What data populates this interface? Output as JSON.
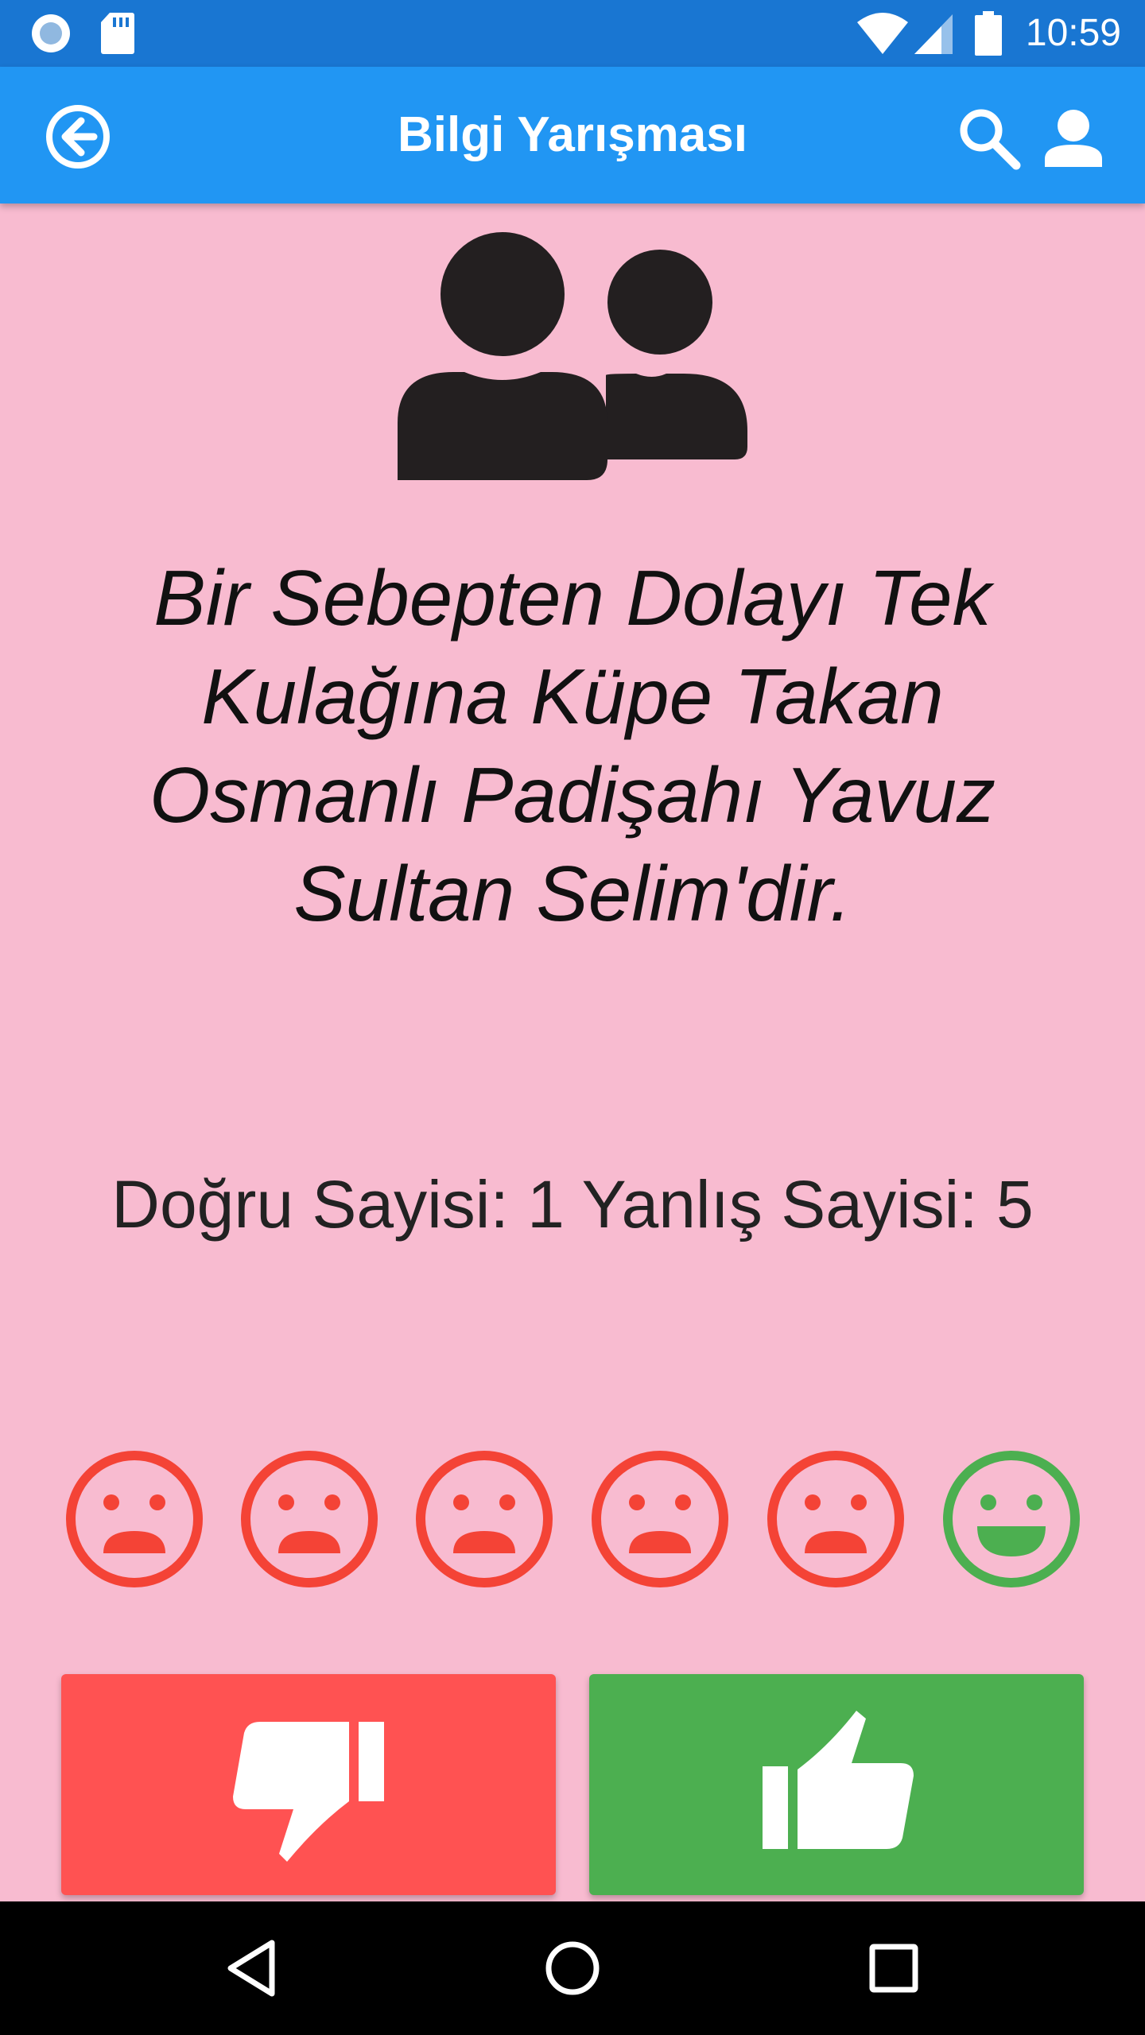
{
  "status_bar": {
    "time": "10:59"
  },
  "app_bar": {
    "title": "Bilgi Yarışması",
    "icons": [
      "back-arrow-circle-icon",
      "search-icon",
      "account-icon"
    ]
  },
  "question": {
    "icon": "people-icon",
    "text": "Bir Sebepten Dolayı Tek Kulağına Küpe Takan Osmanlı Padişahı Yavuz Sultan Selim'dir."
  },
  "score": {
    "text": "Doğru Sayisi: 1 Yanlış Sayisi: 5"
  },
  "results": [
    {
      "state": "wrong",
      "icon": "sad-face-icon",
      "color": "#f44336"
    },
    {
      "state": "wrong",
      "icon": "sad-face-icon",
      "color": "#f44336"
    },
    {
      "state": "wrong",
      "icon": "sad-face-icon",
      "color": "#f44336"
    },
    {
      "state": "wrong",
      "icon": "sad-face-icon",
      "color": "#f44336"
    },
    {
      "state": "wrong",
      "icon": "sad-face-icon",
      "color": "#f44336"
    },
    {
      "state": "correct",
      "icon": "happy-face-icon",
      "color": "#4caf50"
    }
  ],
  "buttons": {
    "false": {
      "icon": "thumbs-down-icon",
      "color": "#ff5252"
    },
    "true": {
      "icon": "thumbs-up-icon",
      "color": "#4caf50"
    }
  },
  "colors": {
    "status_bar": "#1976d2",
    "app_bar": "#2196f3",
    "background": "#f8bbd0"
  }
}
